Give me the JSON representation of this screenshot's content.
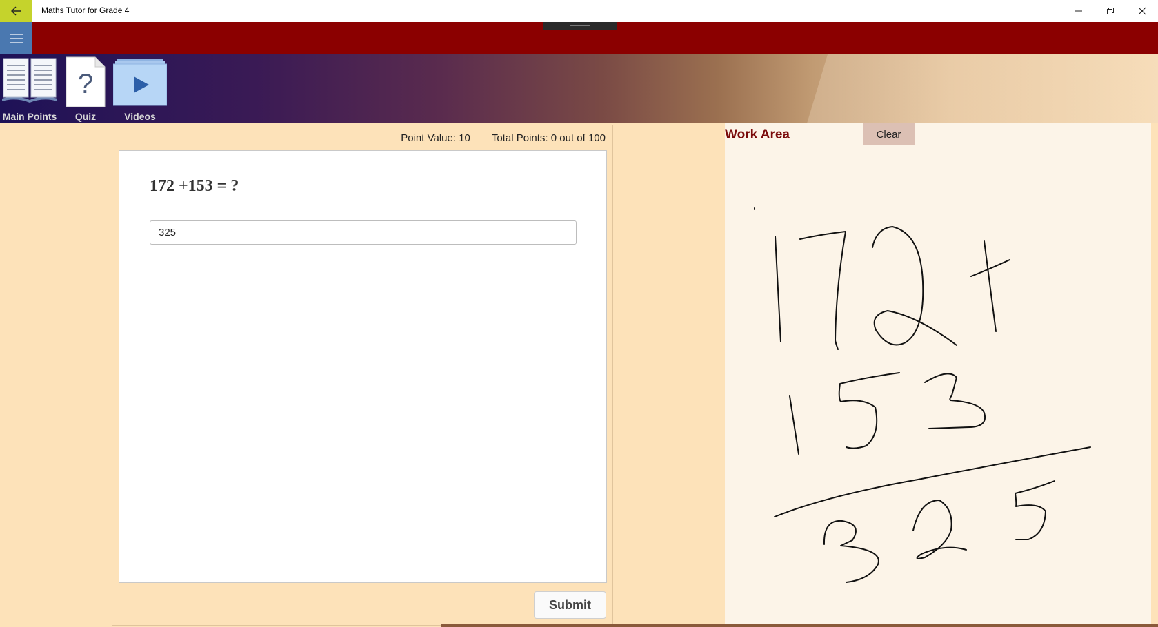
{
  "window": {
    "title": "Maths Tutor for Grade 4",
    "controls": [
      "minimize-icon",
      "restore-icon",
      "close-icon"
    ]
  },
  "nav": {
    "items": [
      {
        "label": "Main Points",
        "icon": "book-icon"
      },
      {
        "label": "Quiz",
        "icon": "question-page-icon"
      },
      {
        "label": "Videos",
        "icon": "video-play-icon"
      }
    ]
  },
  "quiz": {
    "point_value": "Point Value: 10",
    "total_points": "Total Points: 0 out of 100",
    "question": "172 +153 = ?",
    "answer_value": "325",
    "submit_label": "Submit"
  },
  "work_area": {
    "title": "Work Area",
    "clear_label": "Clear",
    "ink_content": "Handwritten: 172 + / 153 / ---- / 325"
  },
  "colors": {
    "title_bar_accent": "#c5d32c",
    "header_bar": "#8b0000",
    "hamburger": "#4a78b0",
    "page_background": "#fde2b9",
    "work_area_background": "#fcf4e8",
    "work_title": "#7a0a0a"
  }
}
